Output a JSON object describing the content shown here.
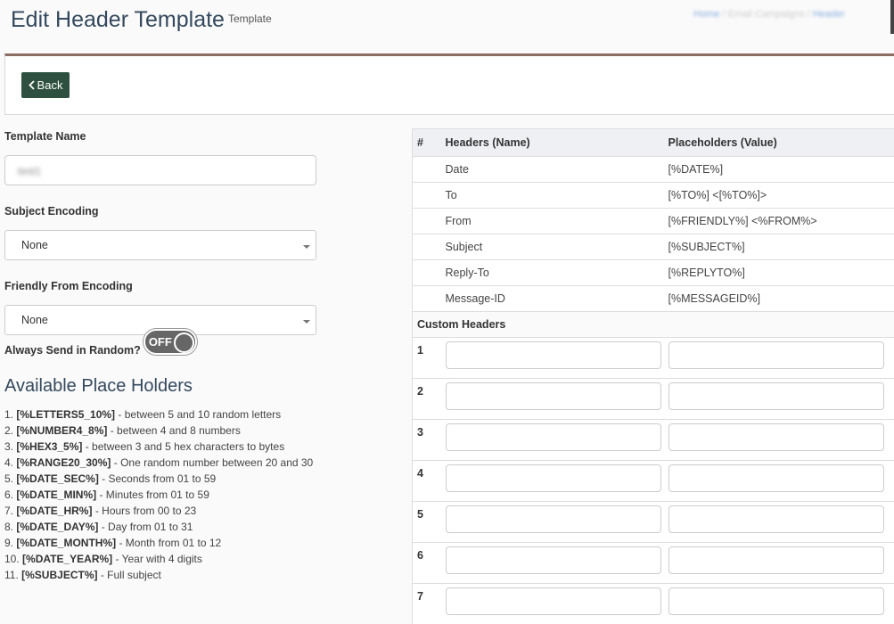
{
  "page": {
    "title": "Edit Header Template",
    "subtitle": "Template"
  },
  "breadcrumb": {
    "home": "Home",
    "item1": "Email Campaigns",
    "item2": "Header"
  },
  "toolbar": {
    "back_label": "Back"
  },
  "form": {
    "template_name_label": "Template Name",
    "template_name_value": "test1",
    "subject_encoding_label": "Subject Encoding",
    "subject_encoding_value": "None",
    "friendly_from_label": "Friendly From Encoding",
    "friendly_from_value": "None",
    "random_label": "Always Send in Random?",
    "random_toggle": "OFF"
  },
  "placeholders": {
    "title": "Available Place Holders",
    "items": [
      {
        "num": "1.",
        "code": "[%LETTERS5_10%]",
        "desc": " - between 5 and 10 random letters"
      },
      {
        "num": "2.",
        "code": "[%NUMBER4_8%]",
        "desc": " - between 4 and 8 numbers"
      },
      {
        "num": "3.",
        "code": "[%HEX3_5%]",
        "desc": " - between 3 and 5 hex characters to bytes"
      },
      {
        "num": "4.",
        "code": "[%RANGE20_30%]",
        "desc": " - One random number between 20 and 30"
      },
      {
        "num": "5.",
        "code": "[%DATE_SEC%]",
        "desc": " - Seconds from 01 to 59"
      },
      {
        "num": "6.",
        "code": "[%DATE_MIN%]",
        "desc": " - Minutes from 01 to 59"
      },
      {
        "num": "7.",
        "code": "[%DATE_HR%]",
        "desc": " - Hours from 00 to 23"
      },
      {
        "num": "8.",
        "code": "[%DATE_DAY%]",
        "desc": " - Day from 01 to 31"
      },
      {
        "num": "9.",
        "code": "[%DATE_MONTH%]",
        "desc": " - Month from 01 to 12"
      },
      {
        "num": "10.",
        "code": "[%DATE_YEAR%]",
        "desc": " - Year with 4 digits"
      },
      {
        "num": "11.",
        "code": "[%SUBJECT%]",
        "desc": " - Full subject"
      }
    ]
  },
  "headers_table": {
    "col_num": "#",
    "col_name": "Headers (Name)",
    "col_value": "Placeholders (Value)",
    "rows": [
      {
        "name": "Date",
        "value": "[%DATE%]"
      },
      {
        "name": "To",
        "value": "[%TO%] <[%TO%]>"
      },
      {
        "name": "From",
        "value": "[%FRIENDLY%] <%FROM%>"
      },
      {
        "name": "Subject",
        "value": "[%SUBJECT%]"
      },
      {
        "name": "Reply-To",
        "value": "[%REPLYTO%]"
      },
      {
        "name": "Message-ID",
        "value": "[%MESSAGEID%]"
      }
    ],
    "custom_label": "Custom Headers",
    "custom_rows": [
      "1",
      "2",
      "3",
      "4",
      "5",
      "6",
      "7"
    ]
  }
}
